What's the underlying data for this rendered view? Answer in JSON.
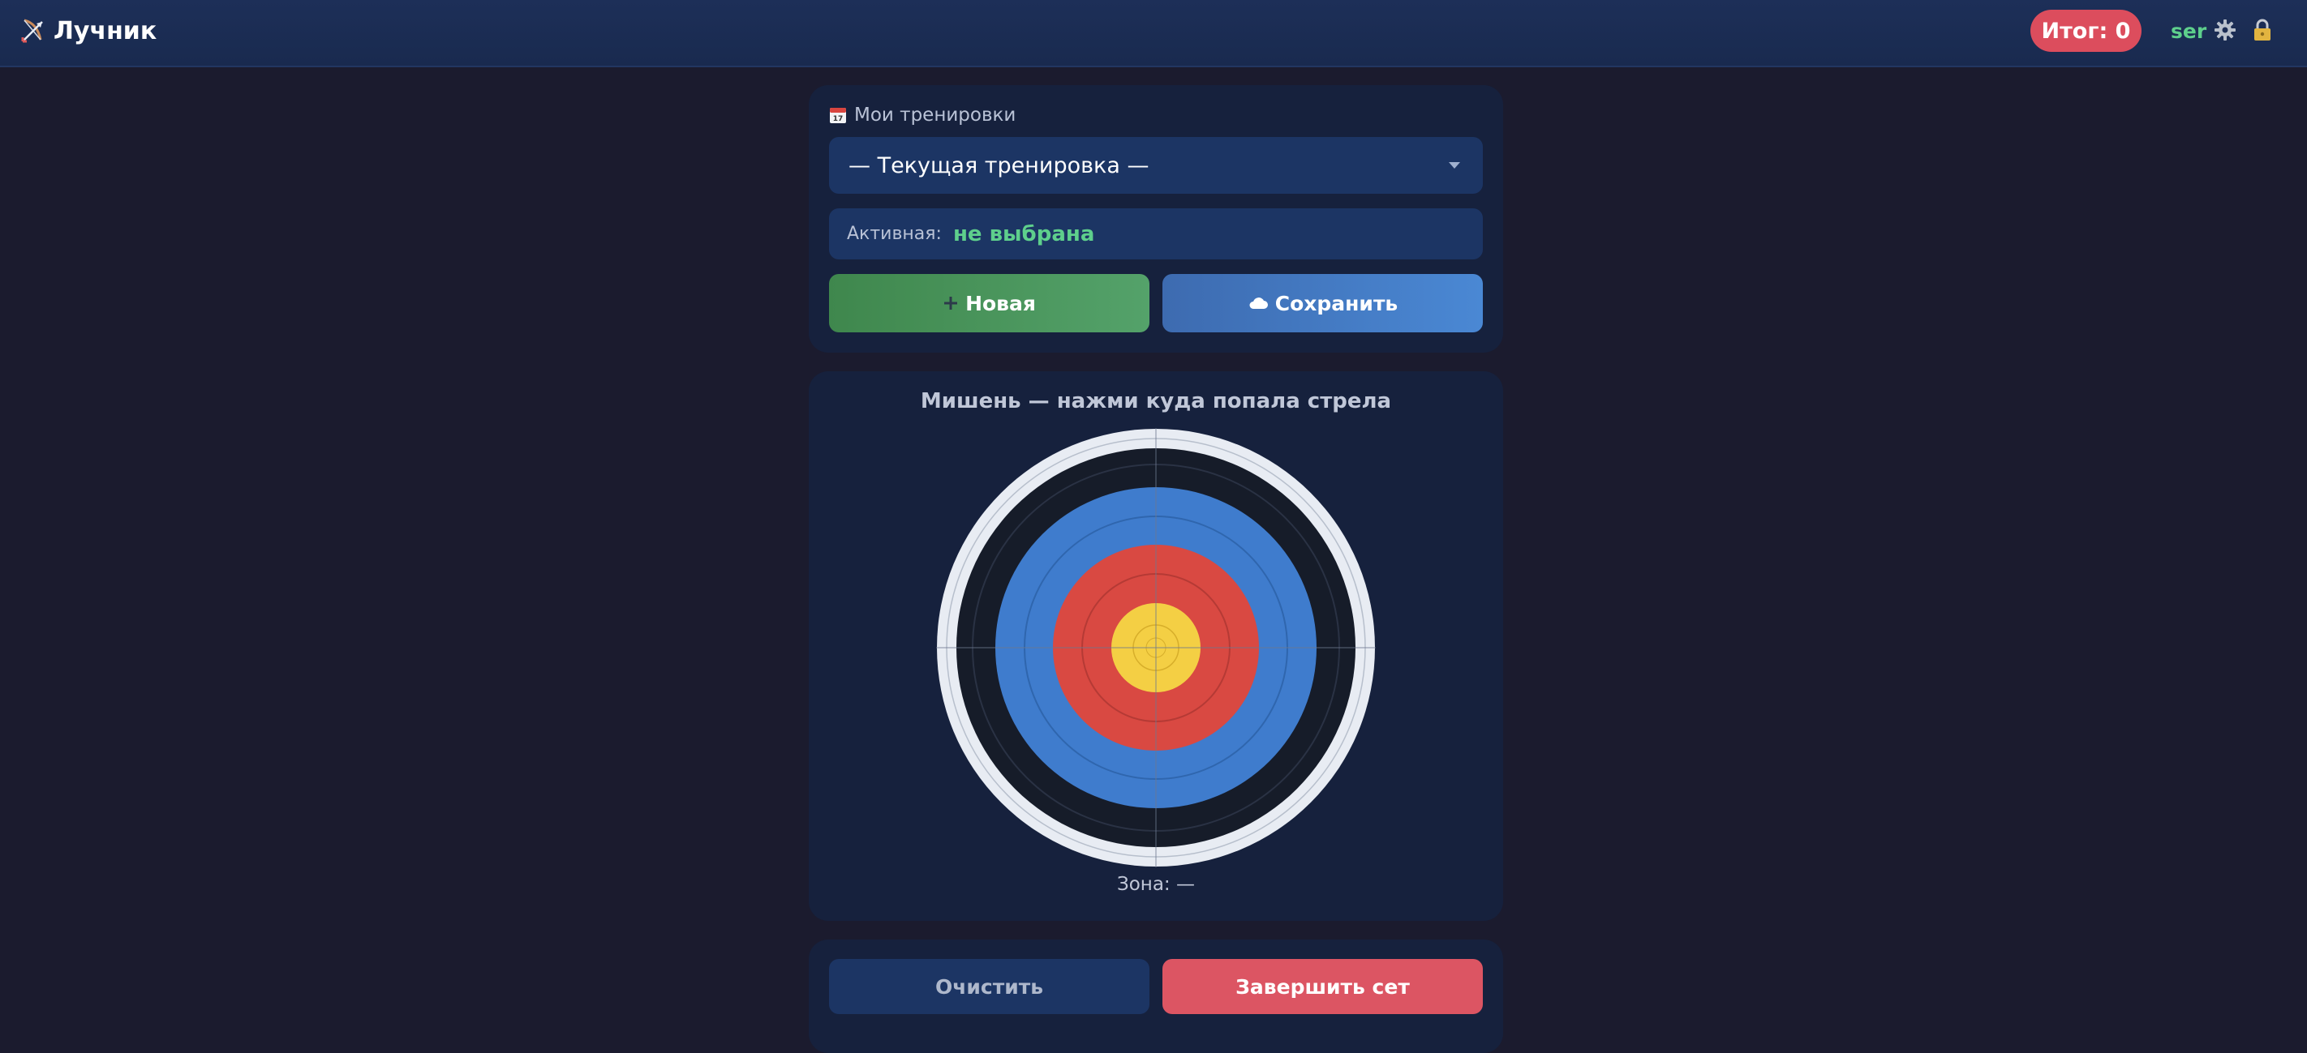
{
  "header": {
    "app_title": "Лучник",
    "score_label": "Итог: 0",
    "username": "ser"
  },
  "trainings": {
    "section_label": "Мои тренировки",
    "select_value": "— Текущая тренировка —",
    "active_label": "Активная:",
    "active_value": "не выбрана",
    "new_button": "Новая",
    "save_button": "Сохранить"
  },
  "target": {
    "title": "Мишень — нажми куда попала стрела",
    "zone_label": "Зона: —"
  },
  "actions": {
    "clear_button": "Очистить",
    "finish_button": "Завершить сет"
  },
  "icons": [
    "bow-arrow-icon",
    "gear-icon",
    "lock-icon",
    "calendar-icon",
    "plus-icon",
    "cloud-icon"
  ],
  "colors": {
    "background": "#1b1b2e",
    "header": "#1d2f58",
    "card": "#16213d",
    "score_badge": "#dc4d5d",
    "username": "#5ecf8c",
    "new_button": "#4a9a5e",
    "save_button": "#4580c7",
    "finish_button": "#dc5563",
    "target_yellow": "#f4cf44",
    "target_red": "#d94942",
    "target_blue": "#3f7ccd",
    "target_black": "#1d2433",
    "target_white": "#e8ecf3"
  }
}
